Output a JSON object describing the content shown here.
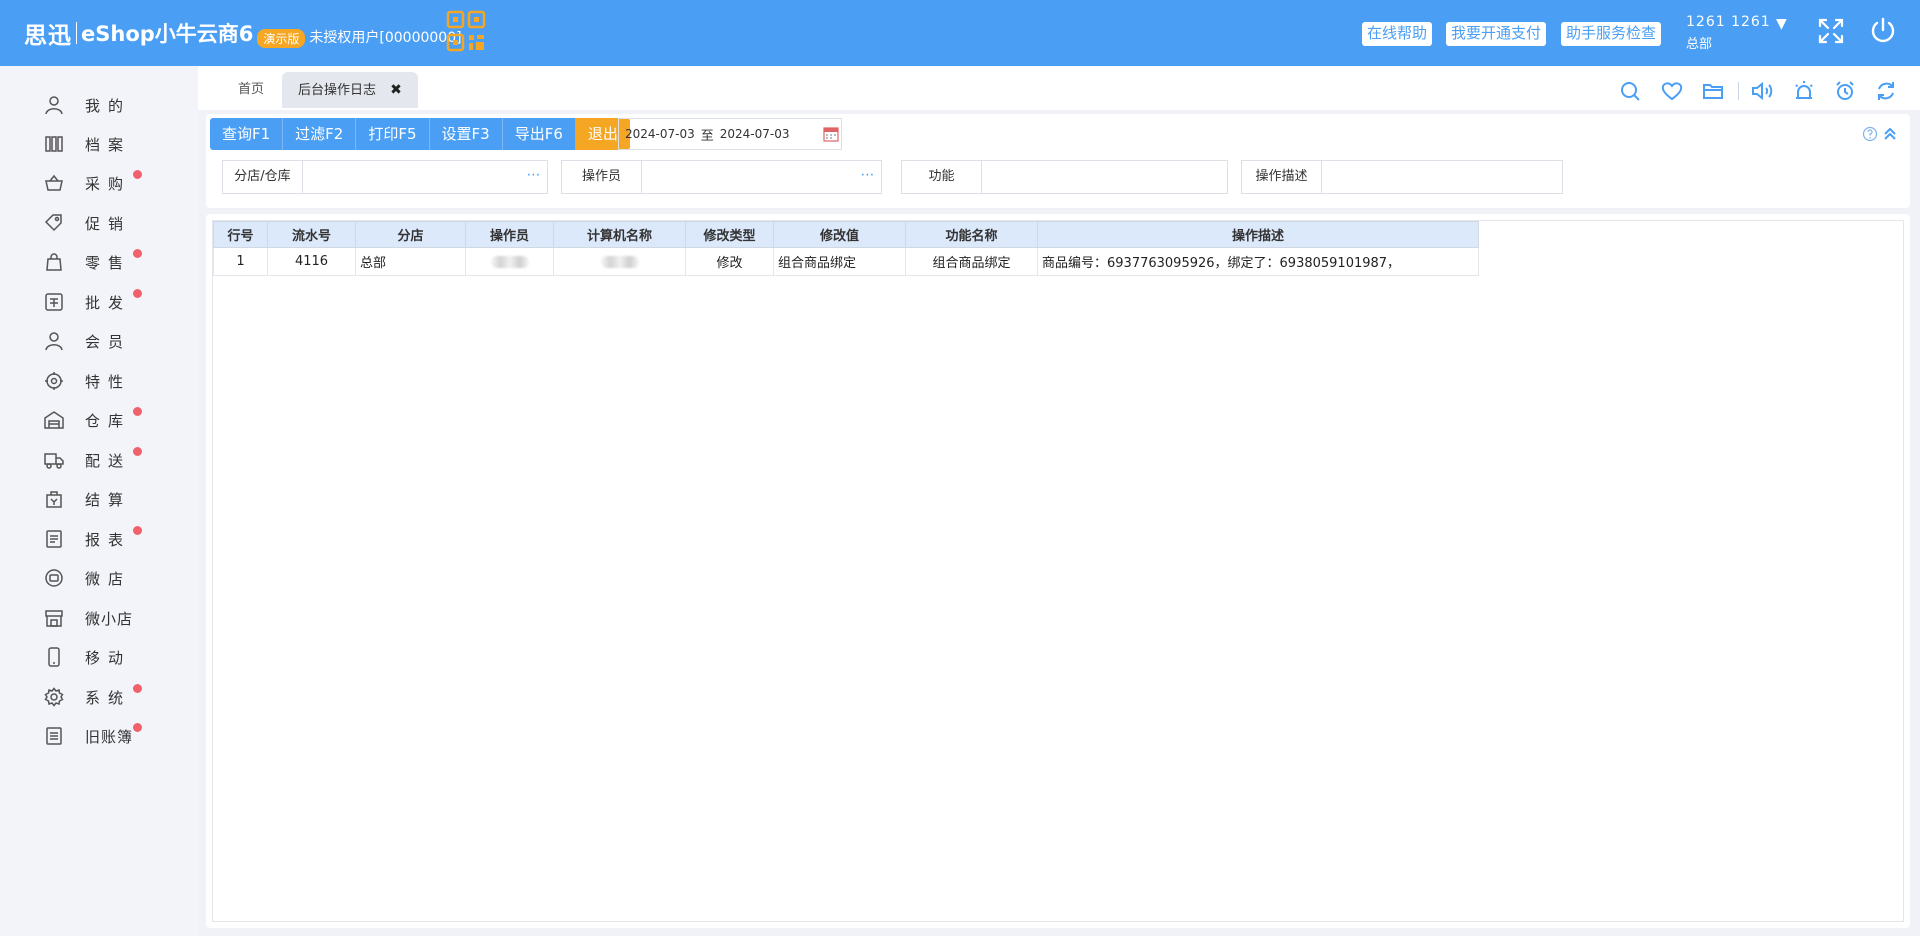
{
  "header": {
    "brand": "思迅",
    "product": "eShop小牛云商6",
    "demo_badge": "演示版",
    "license": "未授权用户[00000000]",
    "buttons": {
      "help": "在线帮助",
      "payment": "我要开通支付",
      "service_check": "助手服务检查"
    },
    "user": {
      "name": "1261 1261",
      "branch": "总部",
      "caret": "▼"
    },
    "colors": {
      "primary": "#4a9ff5",
      "accent": "#f5a623"
    }
  },
  "sidebar": {
    "items": [
      {
        "label": "我的",
        "icon": "user-icon",
        "dot": false
      },
      {
        "label": "档案",
        "icon": "archive-icon",
        "dot": false
      },
      {
        "label": "采购",
        "icon": "basket-icon",
        "dot": true
      },
      {
        "label": "促销",
        "icon": "tag-icon",
        "dot": false
      },
      {
        "label": "零售",
        "icon": "shopping-bag-icon",
        "dot": true
      },
      {
        "label": "批发",
        "icon": "wholesale-icon",
        "dot": true
      },
      {
        "label": "会员",
        "icon": "member-icon",
        "dot": false
      },
      {
        "label": "特性",
        "icon": "feature-icon",
        "dot": false
      },
      {
        "label": "仓库",
        "icon": "warehouse-icon",
        "dot": true
      },
      {
        "label": "配送",
        "icon": "truck-icon",
        "dot": true
      },
      {
        "label": "结算",
        "icon": "settlement-icon",
        "dot": false
      },
      {
        "label": "报表",
        "icon": "report-icon",
        "dot": true
      },
      {
        "label": "微店",
        "icon": "micro-store-icon",
        "dot": false
      },
      {
        "label": "微小店",
        "icon": "mini-store-icon",
        "dot": false
      },
      {
        "label": "移动",
        "icon": "mobile-icon",
        "dot": false
      },
      {
        "label": "系统",
        "icon": "settings-icon",
        "dot": true
      },
      {
        "label": "旧账簿",
        "icon": "ledger-icon",
        "dot": true
      }
    ]
  },
  "tabs": {
    "home": "首页",
    "active": "后台操作日志",
    "close": "✖"
  },
  "toolbar": {
    "query": "查询F1",
    "filter": "过滤F2",
    "print": "打印F5",
    "settings": "设置F3",
    "export": "导出F6",
    "exit": "退出"
  },
  "date_range": {
    "from": "2024-07-03",
    "separator": "至",
    "to": "2024-07-03"
  },
  "filters": {
    "branch_label": "分店/仓库",
    "branch_value": "",
    "operator_label": "操作员",
    "operator_value": "",
    "function_label": "功能",
    "function_value": "",
    "description_label": "操作描述",
    "description_value": "",
    "more": "⋯"
  },
  "grid": {
    "columns": [
      "行号",
      "流水号",
      "分店",
      "操作员",
      "计算机名称",
      "修改类型",
      "修改值",
      "功能名称",
      "操作描述"
    ],
    "rows": [
      {
        "row_no": "1",
        "serial": "4116",
        "branch": "总部",
        "operator": "",
        "computer": "",
        "change_type": "修改",
        "change_value": "组合商品绑定",
        "function_name": "组合商品绑定",
        "description": "商品编号：6937763095926，绑定了：6938059101987，"
      }
    ]
  }
}
